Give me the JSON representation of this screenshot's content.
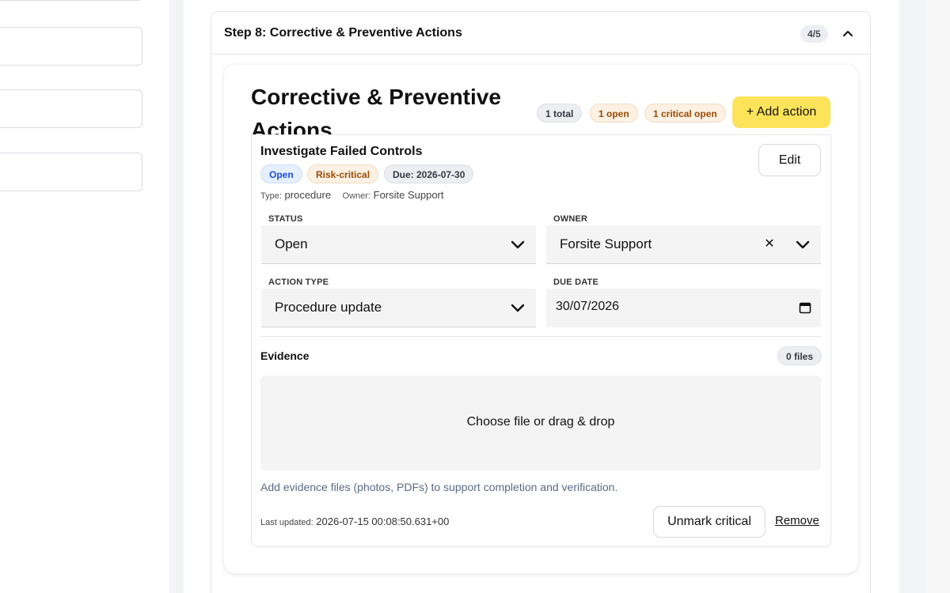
{
  "step": {
    "title": "Step 8: Corrective & Preventive Actions",
    "count": "4/5"
  },
  "section": {
    "title": "Corrective & Preventive Actions",
    "badges": {
      "total": "1 total",
      "open": "1 open",
      "critical_open": "1 critical open"
    },
    "add_label": "+ Add action"
  },
  "action": {
    "title": "Investigate Failed Controls",
    "badges": {
      "status": "Open",
      "risk": "Risk-critical",
      "due": "Due: 2026-07-30"
    },
    "edit_label": "Edit",
    "type_key": "Type:",
    "type_value": "procedure",
    "owner_key": "Owner:",
    "owner_value": "Forsite Support",
    "fields": {
      "status_label": "STATUS",
      "status_value": "Open",
      "owner_label": "OWNER",
      "owner_value": "Forsite Support",
      "action_type_label": "ACTION TYPE",
      "action_type_value": "Procedure update",
      "due_date_label": "DUE DATE",
      "due_date_value": "30/07/2026"
    },
    "evidence": {
      "title": "Evidence",
      "files_badge": "0 files",
      "drop_text": "Choose file or drag & drop",
      "hint": "Add evidence files (photos, PDFs) to support completion and verification."
    },
    "updated_key": "Last updated:",
    "updated_value": "2026-07-15 00:08:50.631+00",
    "unmark_label": "Unmark critical",
    "remove_label": "Remove"
  },
  "icons": {
    "collapse": "chevron-up-icon",
    "dropdown": "chevron-down-icon",
    "clear": "close-icon",
    "date": "calendar-icon"
  }
}
